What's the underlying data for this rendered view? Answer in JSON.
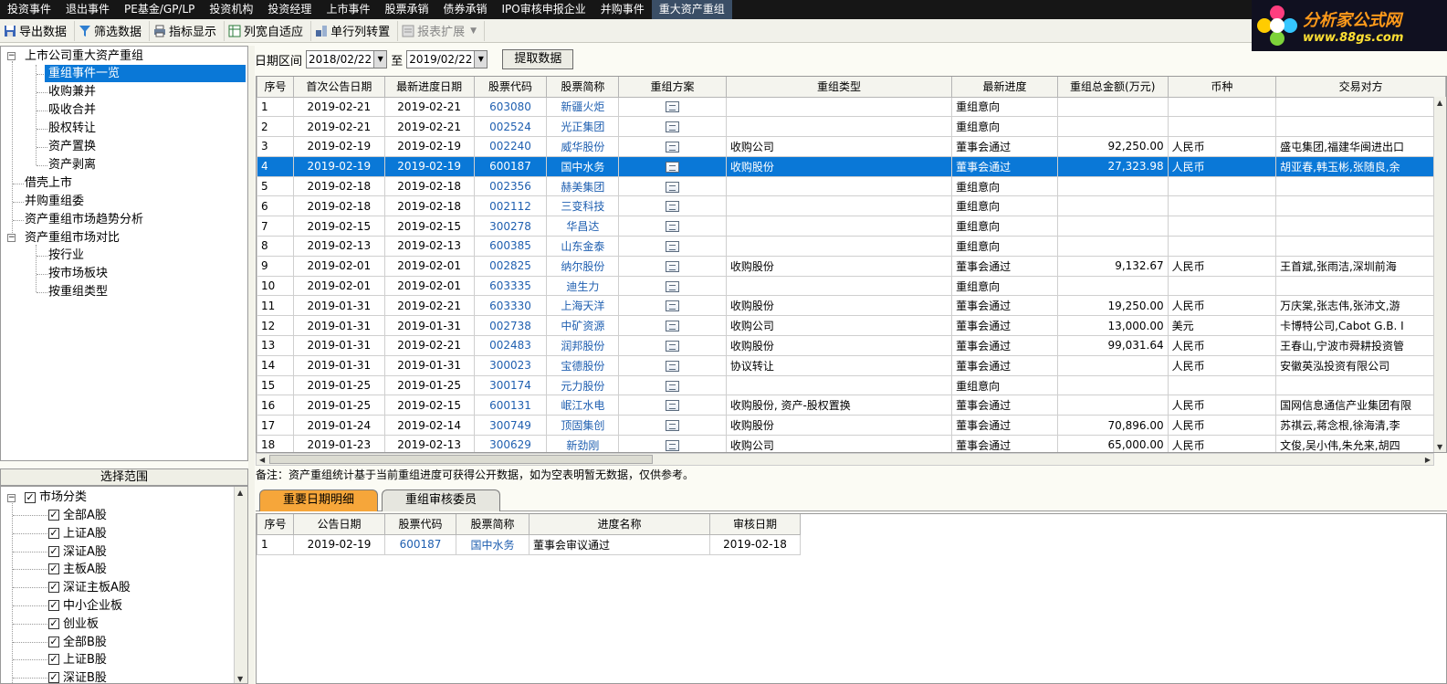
{
  "menubar": {
    "items": [
      "投资事件",
      "退出事件",
      "PE基金/GP/LP",
      "投资机构",
      "投资经理",
      "上市事件",
      "股票承销",
      "债券承销",
      "IPO审核申报企业",
      "并购事件",
      "重大资产重组"
    ],
    "active_index": 10
  },
  "logo": {
    "title": "分析家公式网",
    "url": "www.88gs.com"
  },
  "toolbar": {
    "export": "导出数据",
    "filter": "筛选数据",
    "indicator": "指标显示",
    "autofit": "列宽自适应",
    "transpose": "单行列转置",
    "report_ext": "报表扩展"
  },
  "tree": {
    "root": "上市公司重大资产重组",
    "children": [
      "重组事件一览",
      "收购兼并",
      "吸收合并",
      "股权转让",
      "资产置换",
      "资产剥离"
    ],
    "selected_index": 0,
    "top_items": [
      "借壳上市",
      "并购重组委",
      "资产重组市场趋势分析"
    ],
    "compare": "资产重组市场对比",
    "compare_children": [
      "按行业",
      "按市场板块",
      "按重组类型"
    ]
  },
  "scope": {
    "header": "选择范围",
    "root": "市场分类",
    "items": [
      "全部A股",
      "上证A股",
      "深证A股",
      "主板A股",
      "深证主板A股",
      "中小企业板",
      "创业板",
      "全部B股",
      "上证B股",
      "深证B股"
    ]
  },
  "datebar": {
    "label": "日期区间",
    "start": "2018/02/22",
    "to": "至",
    "end": "2019/02/22",
    "fetch": "提取数据"
  },
  "colors": {
    "highlight": "#0a78d7",
    "link": "#1f5fb0",
    "active_tab": "#f6a63a",
    "menubar_bg": "#161616"
  },
  "grid": {
    "columns": [
      "序号",
      "首次公告日期",
      "最新进度日期",
      "股票代码",
      "股票简称",
      "重组方案",
      "重组类型",
      "最新进度",
      "重组总金额(万元)",
      "币种",
      "交易对方"
    ],
    "highlight_row": 3,
    "rows": [
      {
        "no": "1",
        "first": "2019-02-21",
        "latest": "2019-02-21",
        "code": "603080",
        "name": "新疆火炬",
        "type": "",
        "progress": "重组意向",
        "amount": "",
        "currency": "",
        "party": ""
      },
      {
        "no": "2",
        "first": "2019-02-21",
        "latest": "2019-02-21",
        "code": "002524",
        "name": "光正集团",
        "type": "",
        "progress": "重组意向",
        "amount": "",
        "currency": "",
        "party": ""
      },
      {
        "no": "3",
        "first": "2019-02-19",
        "latest": "2019-02-19",
        "code": "002240",
        "name": "威华股份",
        "type": "收购公司",
        "progress": "董事会通过",
        "amount": "92,250.00",
        "currency": "人民币",
        "party": "盛屯集团,福建华闽进出口"
      },
      {
        "no": "4",
        "first": "2019-02-19",
        "latest": "2019-02-19",
        "code": "600187",
        "name": "国中水务",
        "type": "收购股份",
        "progress": "董事会通过",
        "amount": "27,323.98",
        "currency": "人民币",
        "party": "胡亚春,韩玉彬,张随良,余"
      },
      {
        "no": "5",
        "first": "2019-02-18",
        "latest": "2019-02-18",
        "code": "002356",
        "name": "赫美集团",
        "type": "",
        "progress": "重组意向",
        "amount": "",
        "currency": "",
        "party": ""
      },
      {
        "no": "6",
        "first": "2019-02-18",
        "latest": "2019-02-18",
        "code": "002112",
        "name": "三变科技",
        "type": "",
        "progress": "重组意向",
        "amount": "",
        "currency": "",
        "party": ""
      },
      {
        "no": "7",
        "first": "2019-02-15",
        "latest": "2019-02-15",
        "code": "300278",
        "name": "华昌达",
        "type": "",
        "progress": "重组意向",
        "amount": "",
        "currency": "",
        "party": ""
      },
      {
        "no": "8",
        "first": "2019-02-13",
        "latest": "2019-02-13",
        "code": "600385",
        "name": "山东金泰",
        "type": "",
        "progress": "重组意向",
        "amount": "",
        "currency": "",
        "party": ""
      },
      {
        "no": "9",
        "first": "2019-02-01",
        "latest": "2019-02-01",
        "code": "002825",
        "name": "纳尔股份",
        "type": "收购股份",
        "progress": "董事会通过",
        "amount": "9,132.67",
        "currency": "人民币",
        "party": "王首斌,张雨洁,深圳前海"
      },
      {
        "no": "10",
        "first": "2019-02-01",
        "latest": "2019-02-01",
        "code": "603335",
        "name": "迪生力",
        "type": "",
        "progress": "重组意向",
        "amount": "",
        "currency": "",
        "party": ""
      },
      {
        "no": "11",
        "first": "2019-01-31",
        "latest": "2019-02-21",
        "code": "603330",
        "name": "上海天洋",
        "type": "收购股份",
        "progress": "董事会通过",
        "amount": "19,250.00",
        "currency": "人民币",
        "party": "万庆棠,张志伟,张沛文,游"
      },
      {
        "no": "12",
        "first": "2019-01-31",
        "latest": "2019-01-31",
        "code": "002738",
        "name": "中矿资源",
        "type": "收购公司",
        "progress": "董事会通过",
        "amount": "13,000.00",
        "currency": "美元",
        "party": "卡博特公司,Cabot G.B. I"
      },
      {
        "no": "13",
        "first": "2019-01-31",
        "latest": "2019-02-21",
        "code": "002483",
        "name": "润邦股份",
        "type": "收购股份",
        "progress": "董事会通过",
        "amount": "99,031.64",
        "currency": "人民币",
        "party": "王春山,宁波市舜耕投资管"
      },
      {
        "no": "14",
        "first": "2019-01-31",
        "latest": "2019-01-31",
        "code": "300023",
        "name": "宝德股份",
        "type": "协议转让",
        "progress": "董事会通过",
        "amount": "",
        "currency": "人民币",
        "party": "安徽英泓投资有限公司"
      },
      {
        "no": "15",
        "first": "2019-01-25",
        "latest": "2019-01-25",
        "code": "300174",
        "name": "元力股份",
        "type": "",
        "progress": "重组意向",
        "amount": "",
        "currency": "",
        "party": ""
      },
      {
        "no": "16",
        "first": "2019-01-25",
        "latest": "2019-02-15",
        "code": "600131",
        "name": "岷江水电",
        "type": "收购股份, 资产-股权置换",
        "progress": "董事会通过",
        "amount": "",
        "currency": "人民币",
        "party": "国网信息通信产业集团有限"
      },
      {
        "no": "17",
        "first": "2019-01-24",
        "latest": "2019-02-14",
        "code": "300749",
        "name": "顶固集创",
        "type": "收购股份",
        "progress": "董事会通过",
        "amount": "70,896.00",
        "currency": "人民币",
        "party": "苏祺云,蒋念根,徐海清,李"
      },
      {
        "no": "18",
        "first": "2019-01-23",
        "latest": "2019-02-13",
        "code": "300629",
        "name": "新劲刚",
        "type": "收购公司",
        "progress": "董事会通过",
        "amount": "65,000.00",
        "currency": "人民币",
        "party": "文俊,吴小伟,朱允来,胡四"
      }
    ]
  },
  "note": "备注：资产重组统计基于当前重组进度可获得公开数据，如为空表明暂无数据，仅供参考。",
  "tabs": [
    "重要日期明细",
    "重组审核委员"
  ],
  "detail": {
    "columns": [
      "序号",
      "公告日期",
      "股票代码",
      "股票简称",
      "进度名称",
      "审核日期"
    ],
    "rows": [
      {
        "no": "1",
        "date": "2019-02-19",
        "code": "600187",
        "name": "国中水务",
        "stage": "董事会审议通过",
        "review": "2019-02-18"
      }
    ]
  }
}
